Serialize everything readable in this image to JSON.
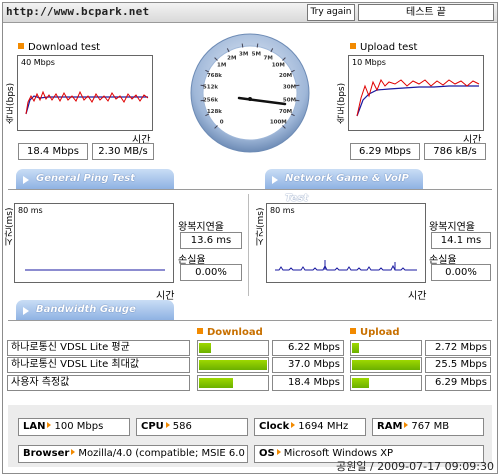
{
  "header": {
    "url": "http://www.bcpark.net",
    "try_again_label": "Try again",
    "status": "테스트 끝"
  },
  "download": {
    "title": "Download test",
    "y_label": "속도(bps)",
    "y_max_label": "40 Mbps",
    "x_label": "시간",
    "mbps": "18.4 Mbps",
    "mbs": "2.30 MB/s"
  },
  "upload": {
    "title": "Upload test",
    "y_label": "속도(bps)",
    "y_max_label": "10 Mbps",
    "x_label": "시간",
    "mbps": "6.29 Mbps",
    "kbs": "786 kB/s"
  },
  "gauge": {
    "ticks": [
      "0",
      "128k",
      "256k",
      "512k",
      "768k",
      "1M",
      "2M",
      "3M",
      "5M",
      "7M",
      "10M",
      "20M",
      "30M",
      "50M",
      "70M",
      "100M"
    ],
    "needle_value": "18.4 Mbps"
  },
  "tabs": {
    "ping": "General Ping Test",
    "game": "Network Game & VoIP Test",
    "bandwidth": "Bandwidth Gauge"
  },
  "ping": {
    "y_label": "시간(ms)",
    "y_max_label": "80 ms",
    "x_label": "시간",
    "rtt_label": "왕복지연율",
    "rtt_value": "13.6 ms",
    "loss_label": "손실율",
    "loss_value": "0.00%"
  },
  "game": {
    "y_label": "시간(ms)",
    "y_max_label": "80 ms",
    "x_label": "시간",
    "rtt_label": "왕복지연율",
    "rtt_value": "14.1 ms",
    "loss_label": "손실율",
    "loss_value": "0.00%"
  },
  "bandwidth": {
    "download_header": "Download",
    "upload_header": "Upload",
    "rows": [
      {
        "label": "하나로통신 VDSL Lite 평균",
        "down": "6.22 Mbps",
        "down_frac": 0.17,
        "up": "2.72 Mbps",
        "up_frac": 0.11
      },
      {
        "label": "하나로통신 VDSL Lite 최대값",
        "down": "37.0 Mbps",
        "down_frac": 1.0,
        "up": "25.5 Mbps",
        "up_frac": 1.0
      },
      {
        "label": "사용자 측정값",
        "down": "18.4 Mbps",
        "down_frac": 0.5,
        "up": "6.29 Mbps",
        "up_frac": 0.25
      }
    ]
  },
  "system": {
    "lan_label": "LAN",
    "lan_value": "100 Mbps",
    "cpu_label": "CPU",
    "cpu_value": "586",
    "clock_label": "Clock",
    "clock_value": "1694 MHz",
    "ram_label": "RAM",
    "ram_value": "767 MB",
    "browser_label": "Browser",
    "browser_value": "Mozilla/4.0 (compatible; MSIE 6.0",
    "os_label": "OS",
    "os_value": "Microsoft Windows XP"
  },
  "stamp": "공원일 / 2009-07-17 09:09:30",
  "colors": {
    "accent_orange": "#f28a00",
    "tab_blue": "#8fb2e3",
    "bar_green": "#7cc000",
    "line_red": "#e00000",
    "line_blue": "#1a1aa0"
  }
}
